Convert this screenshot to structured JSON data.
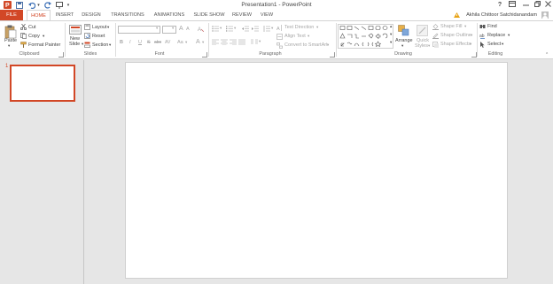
{
  "window": {
    "title": "Presentation1 - PowerPoint",
    "help": "?",
    "controls": [
      "restore-ribbon",
      "minimize",
      "maximize",
      "close"
    ]
  },
  "tabs": {
    "file": "FILE",
    "home": "HOME",
    "insert": "INSERT",
    "design": "DESIGN",
    "transitions": "TRANSITIONS",
    "animations": "ANIMATIONS",
    "slideshow": "SLIDE SHOW",
    "review": "REVIEW",
    "view": "VIEW"
  },
  "user": {
    "name": "Akhila Chittoor Satchidanandam"
  },
  "ribbon": {
    "clipboard": {
      "label": "Clipboard",
      "paste": "Paste",
      "cut": "Cut",
      "copy": "Copy",
      "format_painter": "Format Painter"
    },
    "slides": {
      "label": "Slides",
      "new_slide_1": "New",
      "new_slide_2": "Slide",
      "layout": "Layout",
      "reset": "Reset",
      "section": "Section"
    },
    "font": {
      "label": "Font",
      "bold": "B",
      "italic": "I",
      "underline": "U",
      "strike": "S",
      "shadow": "abc",
      "spacing": "AV",
      "case": "Aa",
      "grow": "A",
      "shrink": "A",
      "color": "A"
    },
    "paragraph": {
      "label": "Paragraph",
      "text_direction": "Text Direction",
      "align_text": "Align Text",
      "smartart": "Convert to SmartArt"
    },
    "drawing": {
      "label": "Drawing",
      "arrange": "Arrange",
      "quick_1": "Quick",
      "quick_2": "Styles",
      "shape_fill": "Shape Fill",
      "shape_outline": "Shape Outline",
      "shape_effects": "Shape Effects"
    },
    "editing": {
      "label": "Editing",
      "find": "Find",
      "replace": "Replace",
      "select": "Select"
    }
  },
  "slides_pane": {
    "slide_number": "1"
  },
  "colors": {
    "accent": "#d24726",
    "ribbon_bg": "#ffffff",
    "workspace_bg": "#e6e6e6"
  }
}
